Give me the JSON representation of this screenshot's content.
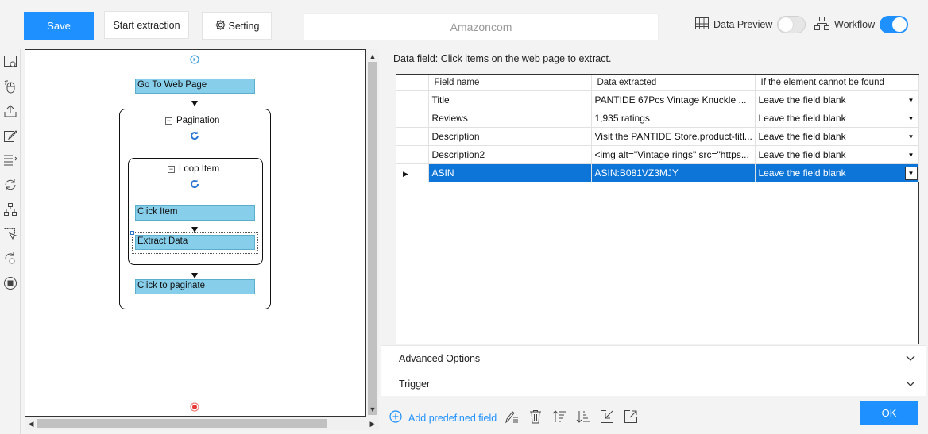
{
  "toolbar": {
    "save": "Save",
    "start_extraction": "Start extraction",
    "setting": "Setting",
    "address": "Amazoncom",
    "data_preview_label": "Data Preview",
    "data_preview_on": false,
    "workflow_label": "Workflow",
    "workflow_on": true,
    "accent_color": "#1e90ff"
  },
  "rail_icons": [
    "page-settings-icon",
    "mouse-click-icon",
    "upload-icon",
    "edit-icon",
    "list-sort-icon",
    "refresh-loop-icon",
    "sitemap-icon",
    "select-pointer-icon",
    "settings-refresh-icon",
    "stop-icon"
  ],
  "workflow": {
    "nodes": {
      "goto": "Go To Web Page",
      "pagination": "Pagination",
      "loop_item": "Loop Item",
      "click_item": "Click Item",
      "extract_data": "Extract Data",
      "click_paginate": "Click to paginate"
    },
    "node_color": "#87ceeb"
  },
  "panel": {
    "hint": "Data field: Click items on the web page to extract.",
    "columns": [
      "Field name",
      "Data extracted",
      "If the element cannot be found"
    ],
    "rows": [
      {
        "field": "Title",
        "data": "PANTIDE 67Pcs Vintage Knuckle ...",
        "fallback": "Leave the field blank"
      },
      {
        "field": "Reviews",
        "data": "1,935 ratings",
        "fallback": "Leave the field blank"
      },
      {
        "field": "Description",
        "data": "Visit the PANTIDE Store.product-titl...",
        "fallback": "Leave the field blank"
      },
      {
        "field": "Description2",
        "data": "<img alt=\"Vintage rings\" src=\"https...",
        "fallback": "Leave the field blank"
      },
      {
        "field": "ASIN",
        "data": "ASIN:B081VZ3MJY",
        "fallback": "Leave the field blank"
      }
    ],
    "selected_row": 4,
    "advanced_options": "Advanced Options",
    "trigger": "Trigger",
    "add_predefined_field": "Add predefined field",
    "ok": "OK"
  }
}
